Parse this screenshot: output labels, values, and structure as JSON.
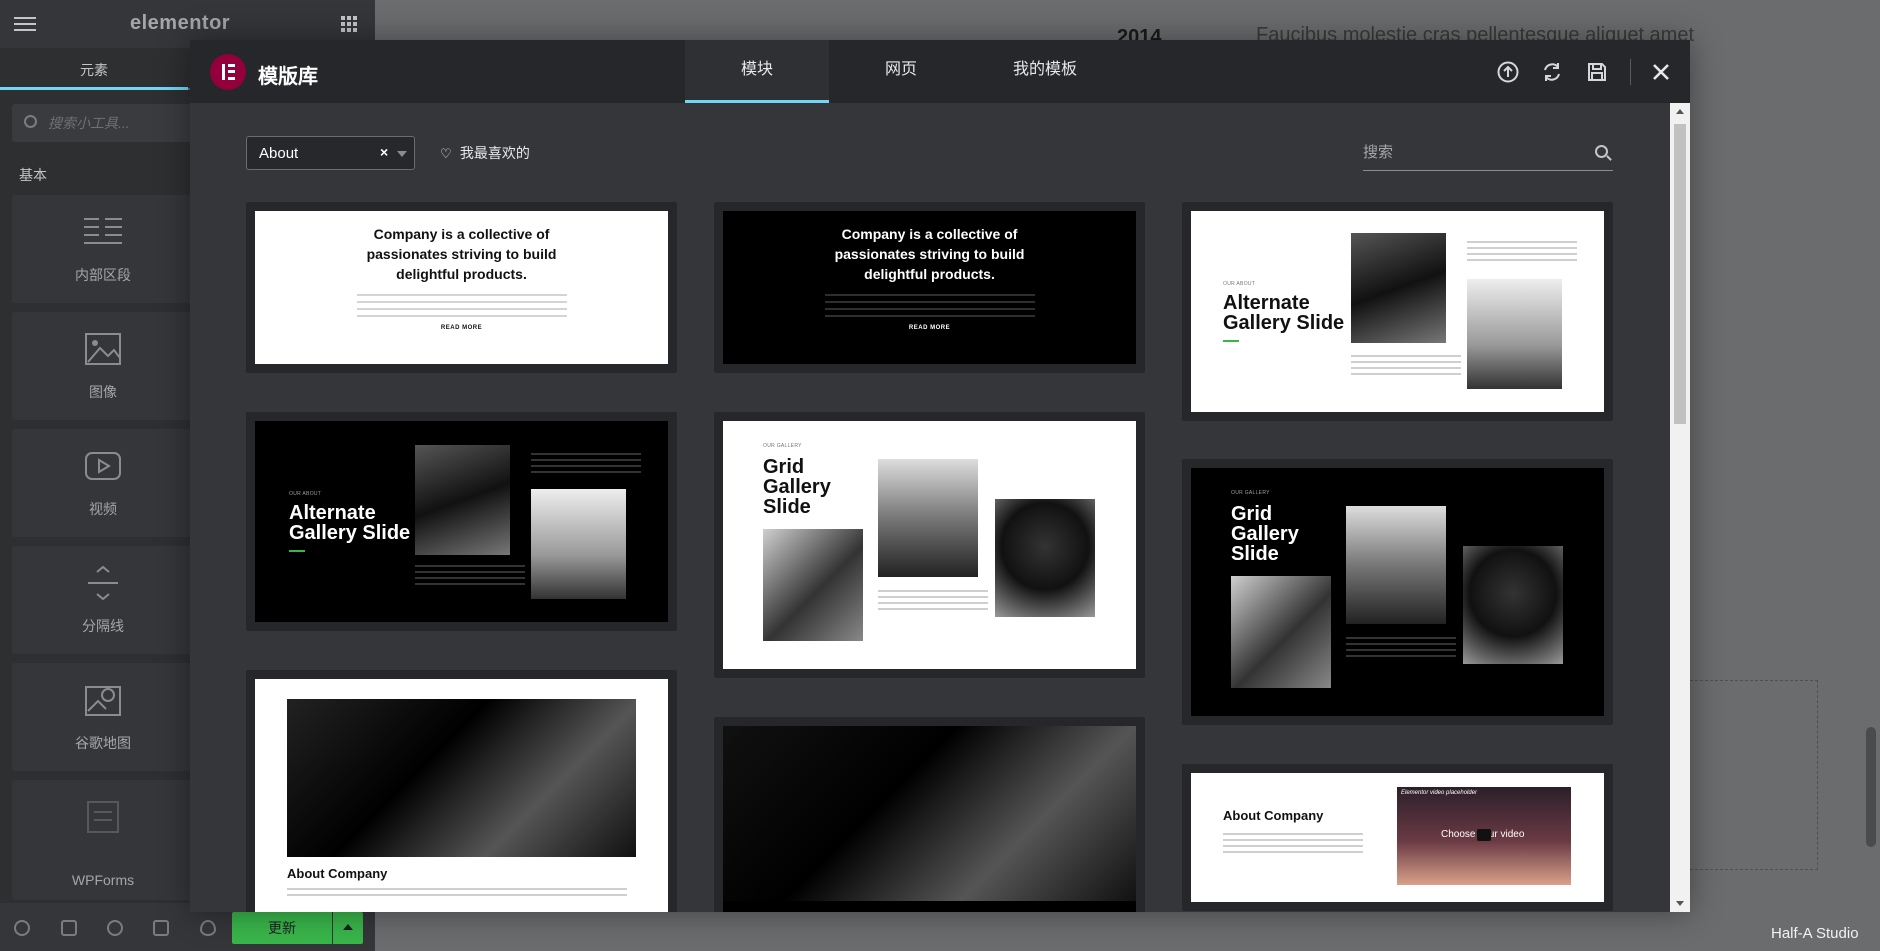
{
  "panel": {
    "logo": "elementor",
    "tab_elements": "元素",
    "search_placeholder": "搜索小工具...",
    "category": "基本",
    "widgets": [
      {
        "label": "内部区段",
        "icon": "inner-section-icon"
      },
      {
        "label": "图像",
        "icon": "image-icon"
      },
      {
        "label": "视频",
        "icon": "video-icon"
      },
      {
        "label": "分隔线",
        "icon": "divider-icon"
      },
      {
        "label": "谷歌地图",
        "icon": "google-maps-icon"
      },
      {
        "label": "WPForms",
        "icon": "wpforms-icon"
      }
    ],
    "update_label": "更新"
  },
  "modal": {
    "title": "模版库",
    "tabs": [
      "模块",
      "网页",
      "我的模板"
    ],
    "active_tab": "模块",
    "header_icons": [
      "upload-icon",
      "sync-icon",
      "save-icon",
      "close-icon"
    ],
    "filter_value": "About",
    "favorites_label": "我最喜欢的",
    "search_placeholder": "搜索"
  },
  "templates": {
    "company_headline_1": "Company is a collective of",
    "company_headline_2": "passionates striving to build",
    "company_headline_3": "delightful products.",
    "read_more": "READ MORE",
    "our_about": "OUR ABOUT",
    "our_gallery": "OUR GALLERY",
    "alt_gallery_1": "Alternate",
    "alt_gallery_2": "Gallery Slide",
    "grid_gallery_1": "Grid",
    "grid_gallery_2": "Gallery",
    "grid_gallery_3": "Slide",
    "about_company": "About Company",
    "video_caption": "Elementor video placeholder",
    "video_choose": "Choose your video"
  },
  "background": {
    "year": "2014",
    "text": "Faucibus molestie cras pellentesque aliquet amet"
  },
  "watermark": "Half-A Studio"
}
